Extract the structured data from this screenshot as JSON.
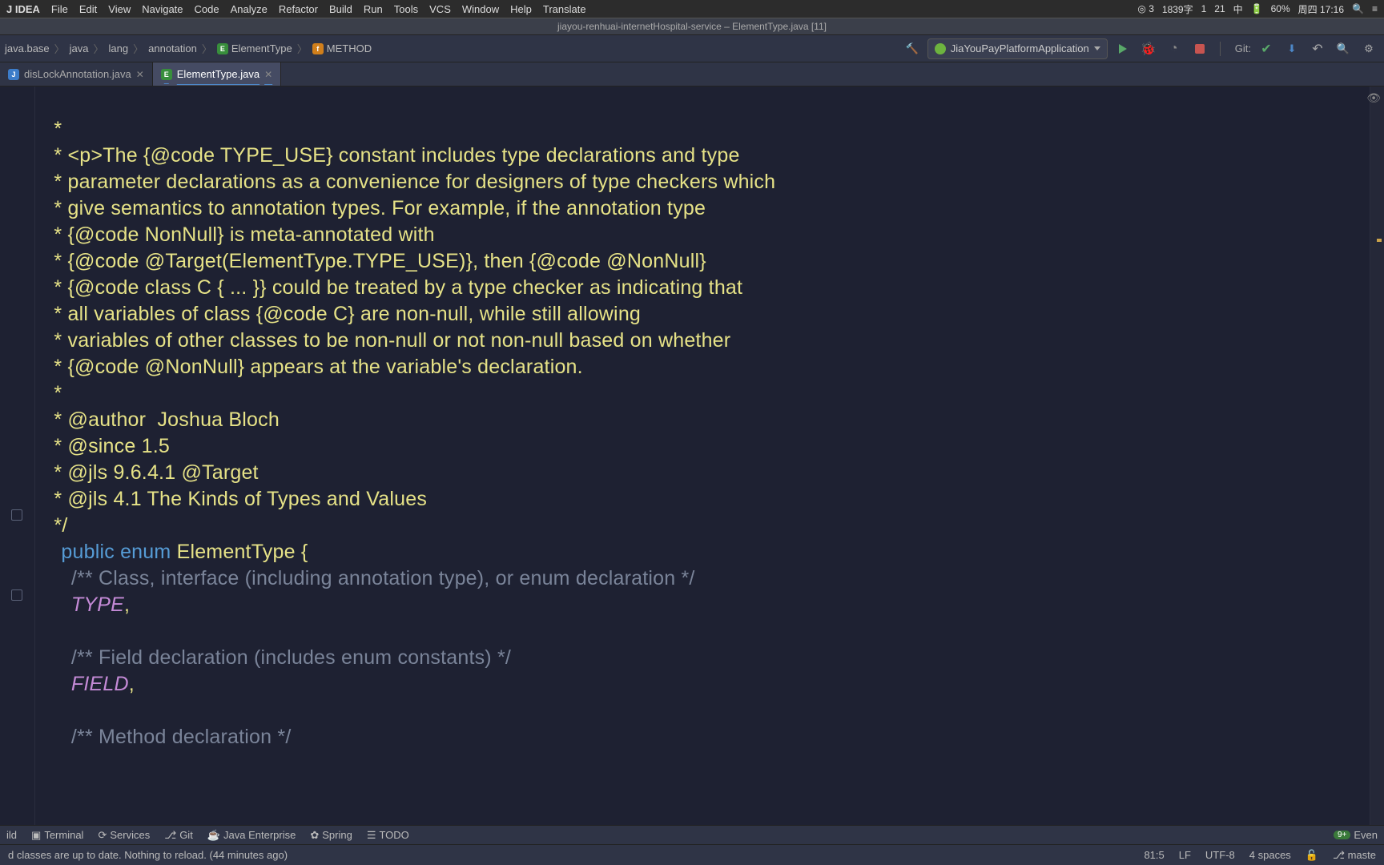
{
  "macbar": {
    "app": "J IDEA",
    "menus": [
      "File",
      "Edit",
      "View",
      "Navigate",
      "Code",
      "Analyze",
      "Refactor",
      "Build",
      "Run",
      "Tools",
      "VCS",
      "Window",
      "Help",
      "Translate"
    ],
    "right": [
      "◎ 3",
      "1839字",
      "1",
      "21",
      "中",
      "60%",
      "周四 17:16"
    ]
  },
  "window_title": "jiayou-renhuai-internetHospital-service – ElementType.java [11]",
  "breadcrumbs": {
    "items": [
      "java.base",
      "java",
      "lang",
      "annotation"
    ],
    "class": "ElementType",
    "member": "METHOD"
  },
  "run_config": "JiaYouPayPlatformApplication",
  "git_label": "Git:",
  "tabs": [
    {
      "name": "disLockAnnotation.java",
      "active": false
    },
    {
      "name": "ElementType.java",
      "active": true
    }
  ],
  "code": {
    "l1": "   *",
    "l2": "   * <p>The {@code TYPE_USE} constant includes type declarations and type",
    "l3": "   * parameter declarations as a convenience for designers of type checkers which",
    "l4": "   * give semantics to annotation types. For example, if the annotation type",
    "l5": "   * {@code NonNull} is meta-annotated with",
    "l6": "   * {@code @Target(ElementType.TYPE_USE)}, then {@code @NonNull}",
    "l7": "   * {@code class C { ... }} could be treated by a type checker as indicating that",
    "l8": "   * all variables of class {@code C} are non-null, while still allowing",
    "l9": "   * variables of other classes to be non-null or not non-null based on whether",
    "l10": "   * {@code @NonNull} appears at the variable's declaration.",
    "l11": "   *",
    "l12": "   * @author  Joshua Bloch",
    "l13": "   * @since 1.5",
    "l14": "   * @jls 9.6.4.1 @Target",
    "l15": "   * @jls 4.1 The Kinds of Types and Values",
    "l16": "   */",
    "l17a": "public",
    "l17b": " enum ",
    "l17c": "ElementType",
    "l17d": " {",
    "l18": "      /** Class, interface (including annotation type), or enum declaration */",
    "l19a": "      ",
    "l19b": "TYPE",
    "l19c": ",",
    "l20": "",
    "l21": "      /** Field declaration (includes enum constants) */",
    "l22a": "      ",
    "l22b": "FIELD",
    "l22c": ",",
    "l23": "",
    "l24": "      /** Method declaration */"
  },
  "toolwindows": {
    "build": "ild",
    "terminal": "Terminal",
    "services": "Services",
    "git": "Git",
    "javaee": "Java Enterprise",
    "spring": "Spring",
    "todo": "TODO",
    "event": "Even",
    "event_badge": "9+"
  },
  "status": {
    "msg": "d classes are up to date. Nothing to reload. (44 minutes ago)",
    "pos": "81:5",
    "lf": "LF",
    "enc": "UTF-8",
    "indent": "4 spaces",
    "branch": "maste"
  }
}
